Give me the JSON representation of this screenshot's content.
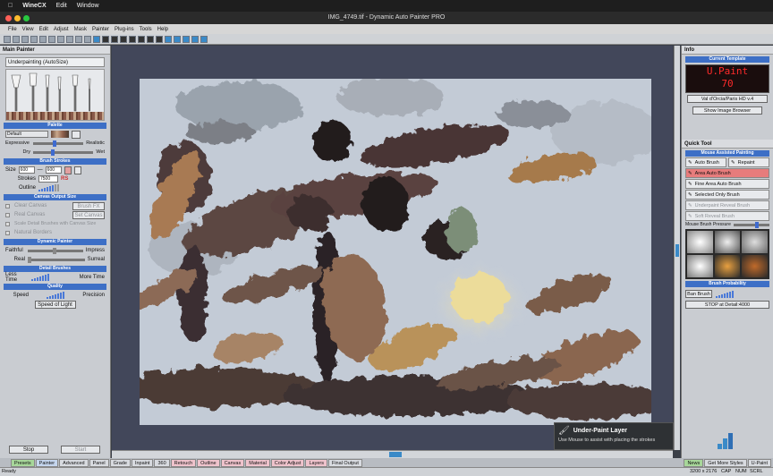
{
  "mac_menu": {
    "app": "WineCX",
    "items": [
      "Edit",
      "Window"
    ]
  },
  "window": {
    "title": "IMG_4749.tif - Dynamic Auto Painter PRO"
  },
  "menu": [
    "File",
    "View",
    "Edit",
    "Adjust",
    "Mask",
    "Painter",
    "Plug-ins",
    "Tools",
    "Help"
  ],
  "left": {
    "title": "Main Painter",
    "preset": "Underpainting (AutoSize)",
    "palette_head": "Palette",
    "palette_value": "Default",
    "expressive": "Expressive",
    "realistic": "Realistic",
    "dry": "Dry",
    "wet": "Wet",
    "brush_strokes": "Brush Strokes",
    "size": "Size",
    "size_min": "600",
    "size_max": "600",
    "strokes": "Strokes",
    "strokes_val": "7500",
    "rs": "RS",
    "outline": "Outline",
    "canvas_output": "Canvas Output Size",
    "clear_canvas": "Clear Canvas",
    "brush_fx": "Brush FX",
    "real_canvas": "Real Canvas",
    "set_canvas": "Set Canvas",
    "scale_detail": "Scale Detail Brushes with Canvas Size",
    "natural_borders": "Natural Borders",
    "dynamic_painter": "Dynamic Painter",
    "faithful": "Faithful",
    "impress": "Impress",
    "real": "Real",
    "surreal": "Surreal",
    "detail_brushes": "Detail Brushes",
    "less_time": "Less Time",
    "more_time": "More Time",
    "quality": "Quality",
    "speed": "Speed",
    "precision": "Precision",
    "speed_of_light": "Speed of Light",
    "stop": "Stop",
    "start": "Start"
  },
  "right": {
    "info": "Info",
    "current_template": "Current Template",
    "led_line1": "U.Paint",
    "led_line2": "70",
    "template_name": "Val d'Orcia/Paris HD v.4",
    "show_browser": "Show Image Browser",
    "quick_tool": "Quick Tool",
    "mouse_assisted": "Mouse Assisted Painting",
    "tools": [
      {
        "label": "Auto Brush",
        "state": "normal"
      },
      {
        "label": "Repaint",
        "state": "normal"
      },
      {
        "label": "Area Auto Brush",
        "state": "active"
      },
      {
        "label": "Fine Area Auto Brush",
        "state": "normal"
      },
      {
        "label": "Selected Only Brush",
        "state": "normal"
      },
      {
        "label": "Underpaint Reveal Brush",
        "state": "disabled"
      },
      {
        "label": "Soft Reveal Brush",
        "state": "disabled"
      }
    ],
    "mouse_brush_pressure": "Mouse Brush Pressure",
    "brush_probability": "Brush Probability",
    "ban_brush": "Ban Brush",
    "stop_detail": "STOP at Detail:4000"
  },
  "tooltip": {
    "title": "Under-Paint Layer",
    "text": "Use Mouse to assist with placing the strokes"
  },
  "tabs": [
    "Presets",
    "Painter",
    "Advanced",
    "Panel",
    "Grade",
    "Inpaint",
    "360",
    "Retouch",
    "Outline",
    "Canvas",
    "Material",
    "Color Adjust",
    "Layers",
    "Final Output"
  ],
  "right_tabs": [
    "News",
    "Get More Styles",
    "U-Paint"
  ],
  "status": {
    "left": "Ready",
    "dims": "3200 x 2176",
    "cap": "CAP",
    "num": "NUM",
    "scrl": "SCRL"
  },
  "colors": {
    "accent": "#3d6fc6",
    "active_tool": "#e77c7c",
    "led": "#ff2a2a"
  }
}
